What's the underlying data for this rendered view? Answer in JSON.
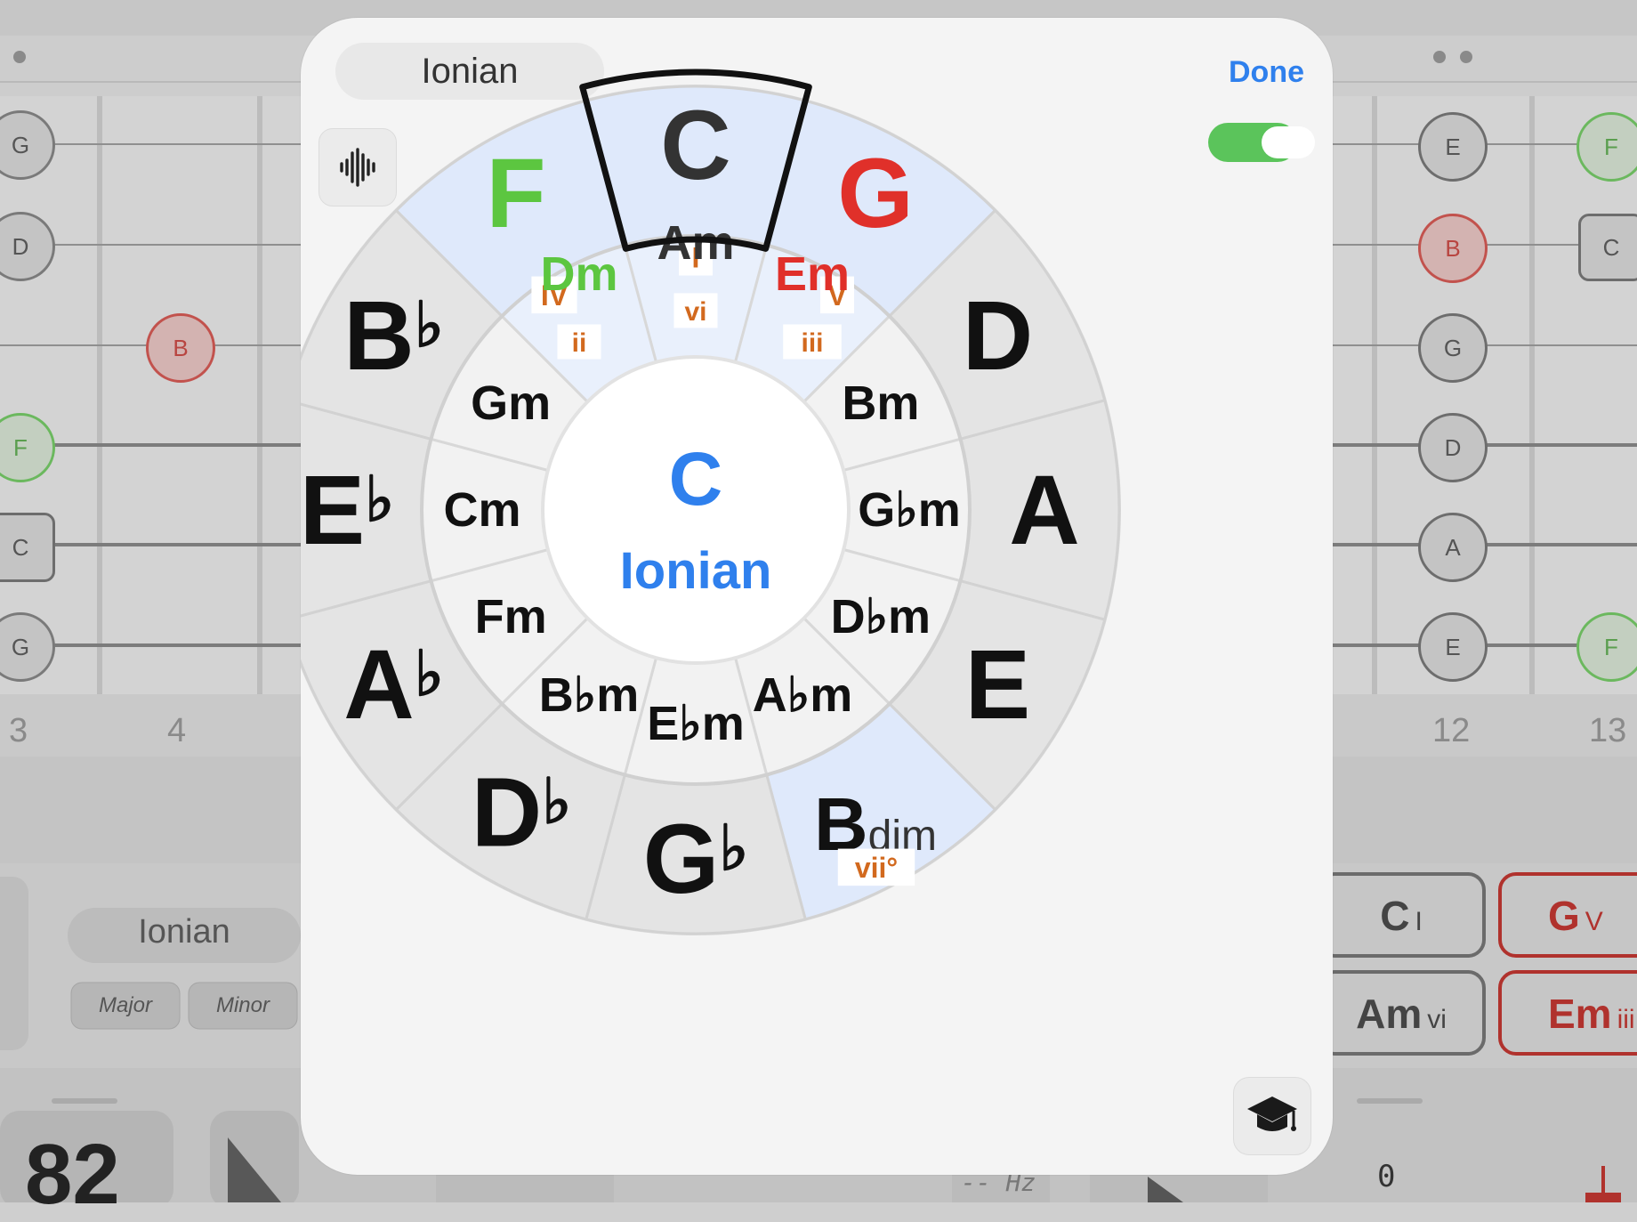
{
  "modal": {
    "mode_label": "Ionian",
    "done_label": "Done",
    "center": {
      "key": "C",
      "mode": "Ionian"
    },
    "outer_ring": [
      {
        "note": "C",
        "acc": "",
        "degree": "I",
        "highlight": true,
        "selected": true
      },
      {
        "note": "G",
        "acc": "",
        "degree": "V",
        "highlight": true
      },
      {
        "note": "D",
        "acc": "",
        "degree": ""
      },
      {
        "note": "A",
        "acc": "",
        "degree": ""
      },
      {
        "note": "E",
        "acc": "",
        "degree": ""
      },
      {
        "note": "B",
        "acc": "",
        "suffix": "dim",
        "degree": "vii°",
        "highlight": true
      },
      {
        "note": "G",
        "acc": "♭",
        "degree": ""
      },
      {
        "note": "D",
        "acc": "♭",
        "degree": ""
      },
      {
        "note": "A",
        "acc": "♭",
        "degree": ""
      },
      {
        "note": "E",
        "acc": "♭",
        "degree": ""
      },
      {
        "note": "B",
        "acc": "♭",
        "degree": ""
      },
      {
        "note": "F",
        "acc": "",
        "degree": "IV",
        "highlight": true
      }
    ],
    "inner_ring": [
      {
        "chord": "Am",
        "degree": "vi",
        "highlight": true
      },
      {
        "chord": "Em",
        "degree": "iii",
        "highlight": true
      },
      {
        "chord": "Bm",
        "degree": ""
      },
      {
        "chord": "G♭m",
        "degree": ""
      },
      {
        "chord": "D♭m",
        "degree": ""
      },
      {
        "chord": "A♭m",
        "degree": ""
      },
      {
        "chord": "E♭m",
        "degree": ""
      },
      {
        "chord": "B♭m",
        "degree": ""
      },
      {
        "chord": "Fm",
        "degree": ""
      },
      {
        "chord": "Cm",
        "degree": ""
      },
      {
        "chord": "Gm",
        "degree": ""
      },
      {
        "chord": "Dm",
        "degree": "ii",
        "highlight": true
      }
    ],
    "colors": {
      "tonic": "#333333",
      "dominant": "#e0302a",
      "subdominant": "#5cc640",
      "degree": "#d2691e",
      "accent": "#2f80ed",
      "highlight_fill": "#dfe9fb",
      "outer_fill": "#e4e4e4",
      "inner_fill": "#f2f2f2"
    }
  },
  "background": {
    "left_strings": [
      "G",
      "D",
      "",
      "F",
      "C",
      "G"
    ],
    "left_fret_marker": "B",
    "left_fret_numbers": [
      "3",
      "4"
    ],
    "right_strings_col1": [
      "E",
      "B",
      "G",
      "D",
      "A",
      "E"
    ],
    "right_strings_col2": [
      "F",
      "C",
      "",
      "",
      "",
      "F"
    ],
    "right_fret_numbers": [
      "12",
      "13"
    ],
    "left_panel": {
      "mode": "Ionian",
      "buttons": [
        "Major",
        "Minor"
      ]
    },
    "tempo": "82",
    "frequency": "-- Hz",
    "counter": "0",
    "chord_buttons": [
      {
        "name": "C",
        "degree": "I",
        "color": "#333333"
      },
      {
        "name": "G",
        "degree": "V",
        "color": "#c0302a"
      },
      {
        "name": "Am",
        "degree": "vi",
        "color": "#333333"
      },
      {
        "name": "Em",
        "degree": "iii",
        "color": "#c0302a"
      }
    ]
  }
}
